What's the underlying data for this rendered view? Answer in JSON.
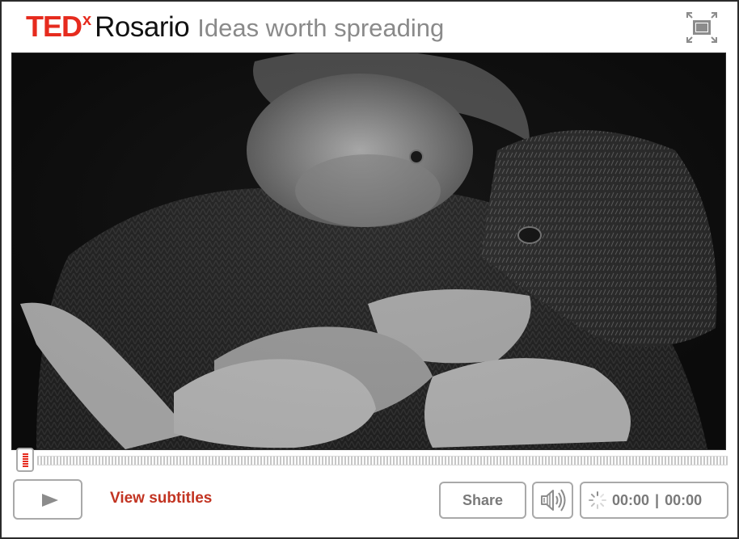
{
  "header": {
    "brand_ted": "TED",
    "brand_x": "x",
    "brand_city": "Rosario",
    "tagline": "Ideas worth spreading"
  },
  "video": {
    "description_icon": "video-frame"
  },
  "controls": {
    "play_icon": "play-icon",
    "subtitles_label": "View subtitles",
    "share_label": "Share",
    "volume_icon": "speaker-icon",
    "fullscreen_icon": "fullscreen-icon",
    "loading_icon": "spinner-icon",
    "current_time": "00:00",
    "separator": "|",
    "duration": "00:00",
    "progress": 0
  },
  "colors": {
    "brand_red": "#e62b1e",
    "subtitle_red": "#c23422",
    "control_gray": "#a9a9a9"
  }
}
